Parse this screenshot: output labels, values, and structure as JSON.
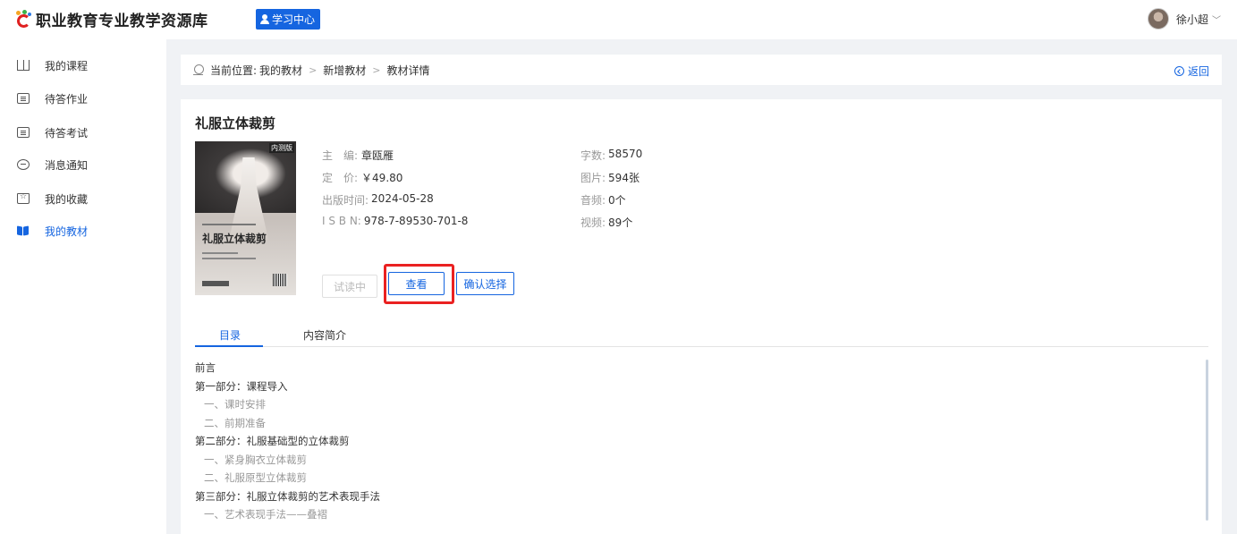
{
  "header": {
    "site_title": "职业教育专业教学资源库",
    "learning_center": "学习中心",
    "user_name": "徐小超"
  },
  "sidebar": {
    "items": [
      {
        "label": "我的课程",
        "icon": "book-icon"
      },
      {
        "label": "待答作业",
        "icon": "homework-icon"
      },
      {
        "label": "待答考试",
        "icon": "exam-icon"
      },
      {
        "label": "消息通知",
        "icon": "message-icon"
      },
      {
        "label": "我的收藏",
        "icon": "favorite-icon"
      },
      {
        "label": "我的教材",
        "icon": "textbook-icon",
        "active": true
      }
    ]
  },
  "breadcrumb": {
    "prefix": "当前位置:",
    "items": [
      "我的教材",
      "新增教材",
      "教材详情"
    ],
    "back": "返回"
  },
  "book": {
    "title": "礼服立体裁剪",
    "cover_tag": "内测版",
    "cover_title": "礼服立体裁剪",
    "editor_key": "主　编:",
    "editor": "章瓯雁",
    "price_key": "定　价:",
    "price": "￥49.80",
    "date_key": "出版时间:",
    "date": "2024-05-28",
    "isbn_key": "I S B N:",
    "isbn": "978-7-89530-701-8",
    "words_key": "字数:",
    "words": "58570",
    "images_key": "图片:",
    "images": "594张",
    "audio_key": "音频:",
    "audio": "0个",
    "video_key": "视频:",
    "video": "89个"
  },
  "actions": {
    "trial": "试读中",
    "view": "查看",
    "confirm": "确认选择"
  },
  "tabs": [
    "目录",
    "内容简介"
  ],
  "toc": [
    {
      "text": "前言",
      "level": 1
    },
    {
      "text": "第一部分：课程导入",
      "level": 1
    },
    {
      "text": "一、课时安排",
      "level": 2
    },
    {
      "text": "二、前期准备",
      "level": 2
    },
    {
      "text": "第二部分：礼服基础型的立体裁剪",
      "level": 1
    },
    {
      "text": "一、紧身胸衣立体裁剪",
      "level": 2
    },
    {
      "text": "二、礼服原型立体裁剪",
      "level": 2
    },
    {
      "text": "第三部分：礼服立体裁剪的艺术表现手法",
      "level": 1
    },
    {
      "text": "一、艺术表现手法——叠褶",
      "level": 2
    }
  ],
  "colors": {
    "accent": "#1565e0",
    "highlight": "#ea2121"
  }
}
